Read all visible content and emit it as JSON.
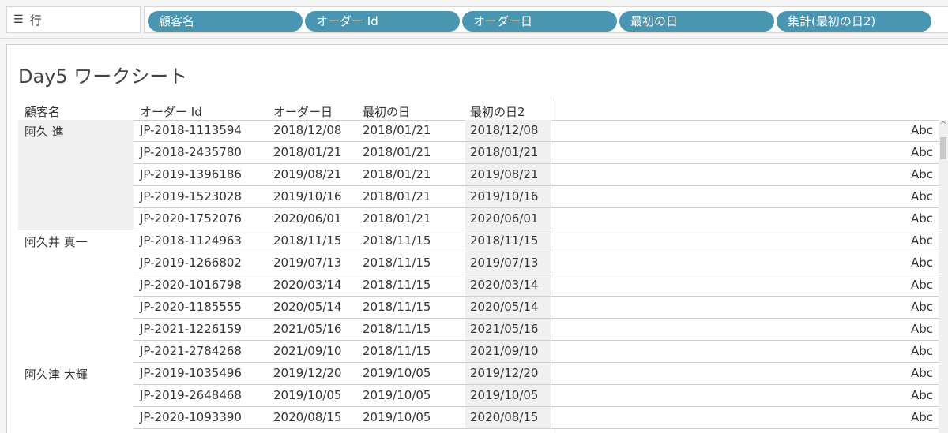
{
  "rows_shelf": {
    "label": "行",
    "icon": "rows-icon"
  },
  "pills": [
    "顧客名",
    "オーダー Id",
    "オーダー日",
    "最初の日",
    "集計(最初の日2)"
  ],
  "sheet": {
    "title": "Day5 ワークシート",
    "headers": [
      "顧客名",
      "オーダー Id",
      "オーダー日",
      "最初の日",
      "最初の日2"
    ],
    "cell_text": "Abc"
  },
  "customers": [
    "阿久 進",
    "阿久井 真一",
    "阿久津 大輝"
  ],
  "rows": [
    [
      "JP-2018-1113594",
      "2018/12/08",
      "2018/01/21",
      "2018/12/08"
    ],
    [
      "JP-2018-2435780",
      "2018/01/21",
      "2018/01/21",
      "2018/01/21"
    ],
    [
      "JP-2019-1396186",
      "2019/08/21",
      "2018/01/21",
      "2019/08/21"
    ],
    [
      "JP-2019-1523028",
      "2019/10/16",
      "2018/01/21",
      "2019/10/16"
    ],
    [
      "JP-2020-1752076",
      "2020/06/01",
      "2018/01/21",
      "2020/06/01"
    ],
    [
      "JP-2018-1124963",
      "2018/11/15",
      "2018/11/15",
      "2018/11/15"
    ],
    [
      "JP-2019-1266802",
      "2019/07/13",
      "2018/11/15",
      "2019/07/13"
    ],
    [
      "JP-2020-1016798",
      "2020/03/14",
      "2018/11/15",
      "2020/03/14"
    ],
    [
      "JP-2020-1185555",
      "2020/05/14",
      "2018/11/15",
      "2020/05/14"
    ],
    [
      "JP-2021-1226159",
      "2021/05/16",
      "2018/11/15",
      "2021/05/16"
    ],
    [
      "JP-2021-2784268",
      "2021/09/10",
      "2018/11/15",
      "2021/09/10"
    ],
    [
      "JP-2019-1035496",
      "2019/12/20",
      "2019/10/05",
      "2019/12/20"
    ],
    [
      "JP-2019-2648468",
      "2019/10/05",
      "2019/10/05",
      "2019/10/05"
    ],
    [
      "JP-2020-1093390",
      "2020/08/15",
      "2019/10/05",
      "2020/08/15"
    ]
  ],
  "pill_color": "#4996b2"
}
